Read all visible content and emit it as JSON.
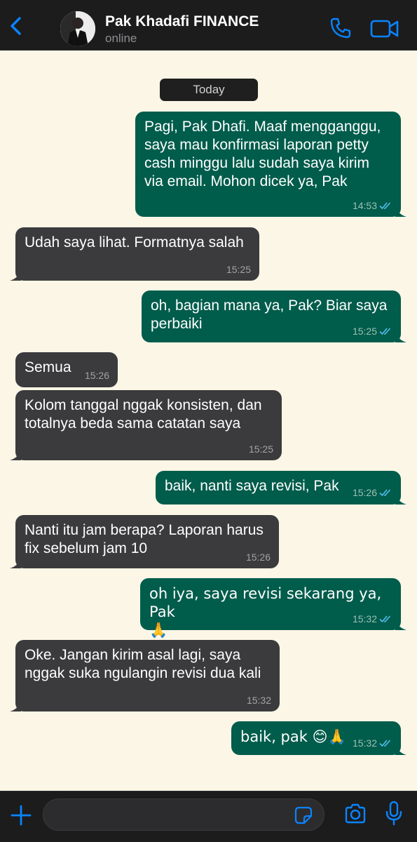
{
  "header": {
    "contact_name": "Pak Khadafi FINANCE",
    "status": "online",
    "icons": [
      "chevron-left-icon",
      "avatar",
      "phone-icon",
      "video-camera-icon"
    ],
    "accent_color": "#0a84ff"
  },
  "chat": {
    "date_label": "Today",
    "messages": [
      {
        "direction": "out",
        "text": "Pagi, Pak Dhafi. Maaf mengganggu,\nsaya mau konfirmasi laporan petty\ncash minggu lalu sudah saya kirim\nvia email. Mohon dicek ya, Pak",
        "time": "14:53",
        "read": true
      },
      {
        "direction": "in",
        "text": "Udah saya lihat. Formatnya salah",
        "time": "15:25"
      },
      {
        "direction": "out",
        "text": "oh, bagian mana ya, Pak? Biar saya\nperbaiki",
        "time": "15:25",
        "read": true
      },
      {
        "direction": "in",
        "text": "Semua",
        "time": "15:26"
      },
      {
        "direction": "in",
        "text": "Kolom tanggal nggak konsisten, dan\ntotalnya beda sama catatan saya",
        "time": "15:25"
      },
      {
        "direction": "out",
        "text": "baik, nanti saya revisi, Pak",
        "time": "15:26",
        "read": true
      },
      {
        "direction": "in",
        "text": "Nanti itu jam berapa? Laporan harus\nfix sebelum jam 10",
        "time": "15:26"
      },
      {
        "direction": "out",
        "text": "oh iya, saya revisi sekarang ya, Pak\n🙏",
        "time": "15:32",
        "read": true
      },
      {
        "direction": "in",
        "text": "Oke. Jangan kirim asal lagi, saya\nnggak suka ngulangin revisi dua kali",
        "time": "15:32"
      },
      {
        "direction": "out",
        "text": "baik, pak 😊🙏",
        "time": "15:32",
        "read": true
      }
    ],
    "colors": {
      "incoming": "#3b3b3d",
      "outgoing": "#005c4b",
      "wallpaper": "#fbf6e6",
      "read_ticks": "#53bdeb"
    }
  },
  "composer": {
    "placeholder": "",
    "icons": [
      "plus-icon",
      "sticker-icon",
      "camera-icon",
      "microphone-icon"
    ]
  }
}
